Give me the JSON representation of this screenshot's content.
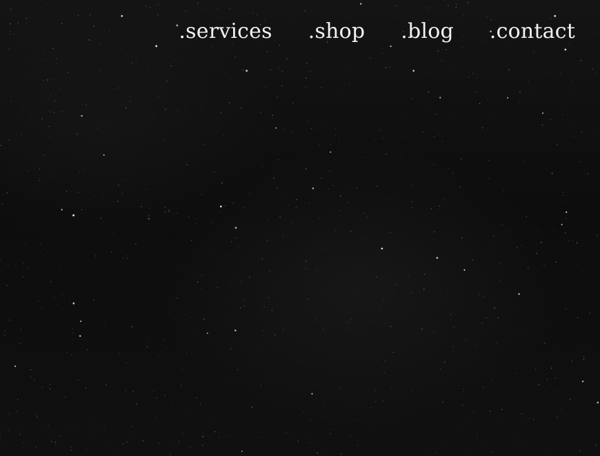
{
  "nav": {
    "items": [
      {
        "label": ".services"
      },
      {
        "label": ".shop"
      },
      {
        "label": ".blog"
      },
      {
        "label": ".contact"
      }
    ]
  },
  "background": {
    "base_color": "#0b0b0b",
    "speckle_color": "#ffffff"
  }
}
